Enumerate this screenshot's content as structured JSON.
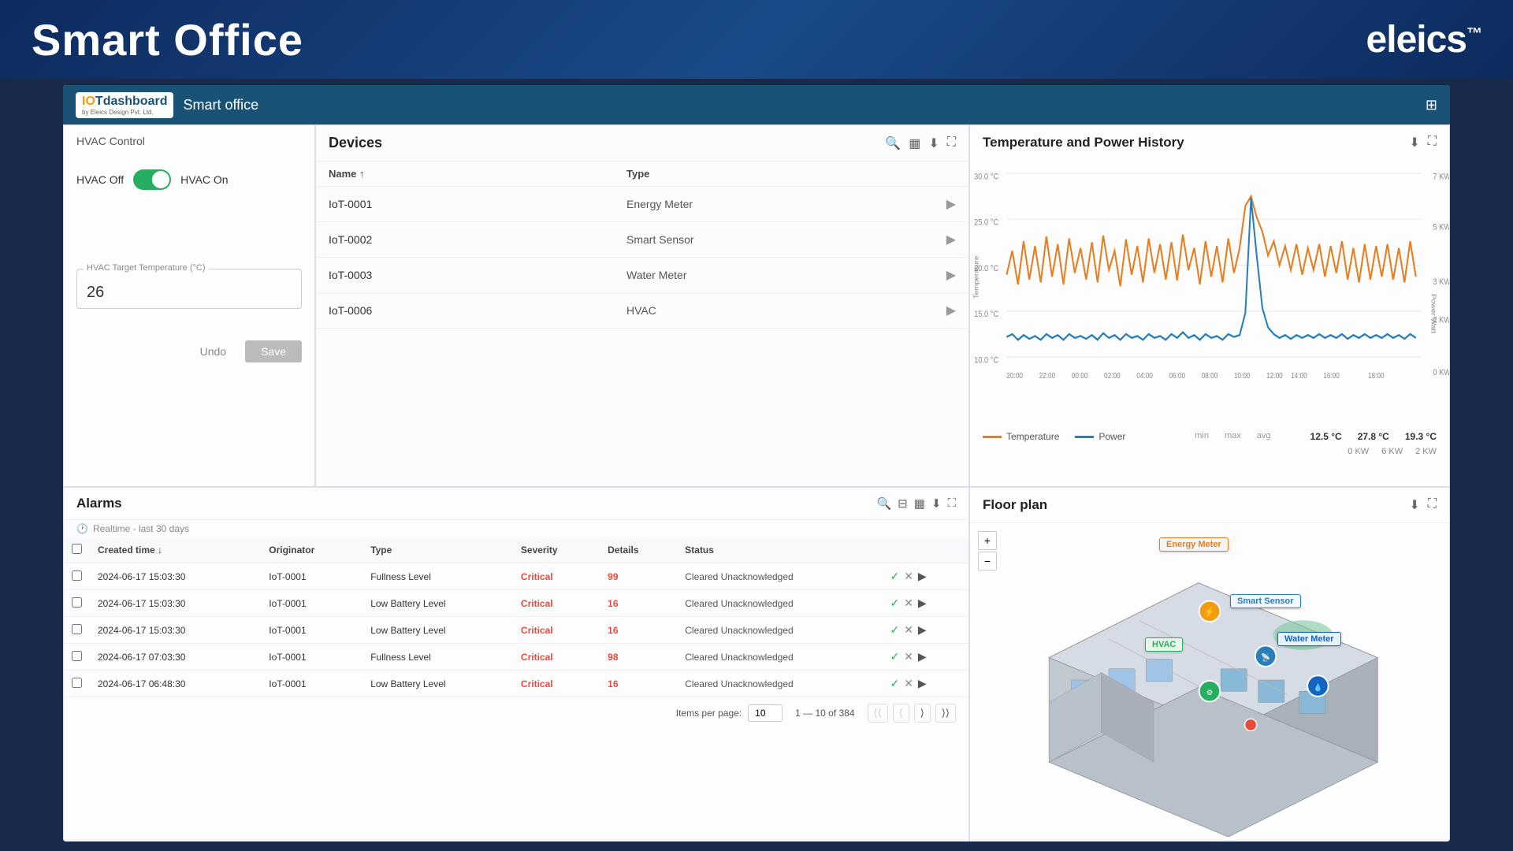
{
  "header": {
    "title": "Smart Office",
    "logo": "eleics",
    "logo_tm": "™"
  },
  "dashboard": {
    "bar_title": "Smart office",
    "logo_text": "IOTdashboard",
    "logo_sub": "by Eleics Design Pvt. Ltd."
  },
  "hvac": {
    "panel_title": "HVAC Control",
    "label_off": "HVAC Off",
    "label_on": "HVAC On",
    "temp_label": "HVAC Target Temperature (°C)",
    "temp_value": "26",
    "btn_undo": "Undo",
    "btn_save": "Save"
  },
  "devices": {
    "panel_title": "Devices",
    "col_name": "Name",
    "col_type": "Type",
    "items": [
      {
        "id": "IoT-0001",
        "type": "Energy Meter"
      },
      {
        "id": "IoT-0002",
        "type": "Smart Sensor"
      },
      {
        "id": "IoT-0003",
        "type": "Water Meter"
      },
      {
        "id": "IoT-0006",
        "type": "HVAC"
      }
    ]
  },
  "temperature_panel": {
    "title": "Temperature and Power History",
    "legend_temp": "Temperature",
    "legend_power": "Power",
    "stats": {
      "min_label": "min",
      "max_label": "max",
      "avg_label": "avg",
      "temp_min": "12.5 °C",
      "temp_max": "27.8 °C",
      "temp_avg": "19.3 °C",
      "power_min": "0 KW",
      "power_max": "6 KW",
      "power_avg": "2 KW"
    },
    "y_left": [
      "30.0 °C",
      "25.0 °C",
      "20.0 °C",
      "15.0 °C",
      "10.0 °C"
    ],
    "y_right": [
      "7 KW",
      "5 KW",
      "3 KW",
      "2 KW",
      "0 KW"
    ],
    "x_labels": [
      "20:00",
      "22:00",
      "00:00",
      "02:00",
      "04:00",
      "06:00",
      "08:00",
      "10:00",
      "12:00",
      "14:00",
      "16:00",
      "18:00"
    ]
  },
  "alarms": {
    "panel_title": "Alarms",
    "subtitle": "Realtime - last 30 days",
    "cols": [
      "Created time",
      "Originator",
      "Type",
      "Severity",
      "Details",
      "Status"
    ],
    "rows": [
      {
        "date": "2024-06-17 15:03:30",
        "originator": "IoT-0001",
        "type": "Fullness Level",
        "severity": "Critical",
        "details": "99",
        "status": "Cleared Unacknowledged"
      },
      {
        "date": "2024-06-17 15:03:30",
        "originator": "IoT-0001",
        "type": "Low Battery Level",
        "severity": "Critical",
        "details": "16",
        "status": "Cleared Unacknowledged"
      },
      {
        "date": "2024-06-17 15:03:30",
        "originator": "IoT-0001",
        "type": "Low Battery Level",
        "severity": "Critical",
        "details": "16",
        "status": "Cleared Unacknowledged"
      },
      {
        "date": "2024-06-17 07:03:30",
        "originator": "IoT-0001",
        "type": "Fullness Level",
        "severity": "Critical",
        "details": "98",
        "status": "Cleared Unacknowledged"
      },
      {
        "date": "2024-06-17 06:48:30",
        "originator": "IoT-0001",
        "type": "Low Battery Level",
        "severity": "Critical",
        "details": "16",
        "status": "Cleared Unacknowledged"
      }
    ],
    "footer": {
      "items_label": "Items per page:",
      "per_page": "10",
      "range": "1 — 10 of 384"
    }
  },
  "floor_plan": {
    "title": "Floor plan",
    "labels": {
      "energy_meter": "Energy Meter",
      "smart_sensor": "Smart Sensor",
      "hvac": "HVAC",
      "water_meter": "Water Meter"
    }
  }
}
